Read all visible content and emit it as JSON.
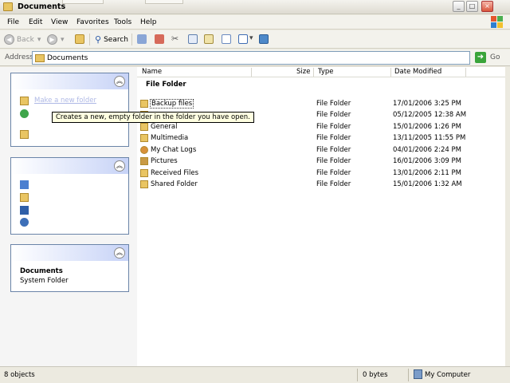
{
  "window": {
    "title": "Documents",
    "buttons": {
      "minimize": "_",
      "maximize": "□",
      "close": "×"
    }
  },
  "menu": {
    "items": [
      "File",
      "Edit",
      "View",
      "Favorites",
      "Tools",
      "Help"
    ]
  },
  "toolbar": {
    "back_label": "Back",
    "search_label": "Search"
  },
  "address": {
    "label": "Address",
    "value": "Documents",
    "go_label": "Go"
  },
  "tooltip": {
    "text": "Creates a new, empty folder in the folder you have open."
  },
  "task_pane": {
    "task_link": "Make a new folder",
    "details_title": "Documents",
    "details_subtitle": "System Folder"
  },
  "columns": {
    "name": "Name",
    "size": "Size",
    "type": "Type",
    "date": "Date Modified"
  },
  "group_title": "File Folder",
  "files": [
    {
      "name": "Backup files",
      "type": "File Folder",
      "date": "17/01/2006 3:25 PM",
      "icon": "folder-icon"
    },
    {
      "name": "",
      "type": "File Folder",
      "date": "05/12/2005 12:38 AM",
      "icon": "folder-icon"
    },
    {
      "name": "General",
      "type": "File Folder",
      "date": "15/01/2006 1:26 PM",
      "icon": "folder-icon"
    },
    {
      "name": "Multimedia",
      "type": "File Folder",
      "date": "13/11/2005 11:55 PM",
      "icon": "folder-icon"
    },
    {
      "name": "My Chat Logs",
      "type": "File Folder",
      "date": "04/01/2006 2:24 PM",
      "icon": "chat-folder-icon"
    },
    {
      "name": "Pictures",
      "type": "File Folder",
      "date": "16/01/2006 3:09 PM",
      "icon": "pictures-folder-icon"
    },
    {
      "name": "Received Files",
      "type": "File Folder",
      "date": "13/01/2006 2:11 PM",
      "icon": "folder-icon"
    },
    {
      "name": "Shared Folder",
      "type": "File Folder",
      "date": "15/01/2006 1:32 AM",
      "icon": "folder-icon"
    }
  ],
  "status": {
    "objects": "8 objects",
    "size": "0 bytes",
    "location": "My Computer"
  }
}
